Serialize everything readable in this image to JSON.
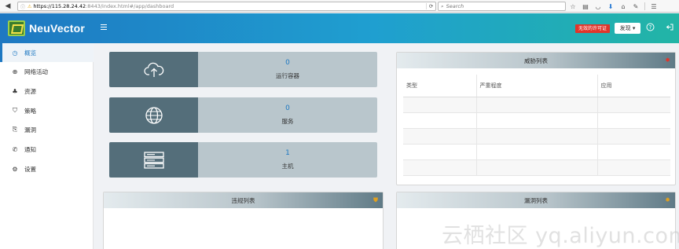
{
  "browser": {
    "url_host": "https://115.28.24.42",
    "url_rest": ":8443/index.html#/app/dashboard",
    "search_placeholder": "Search"
  },
  "header": {
    "logo_text": "NeuVector",
    "license_badge": "无效的许可证",
    "language_button": "发现 ▾"
  },
  "sidebar": {
    "items": [
      {
        "label": "概览",
        "icon": "dashboard-icon"
      },
      {
        "label": "网络活动",
        "icon": "globe-icon"
      },
      {
        "label": "资源",
        "icon": "resources-icon"
      },
      {
        "label": "策略",
        "icon": "shield-icon"
      },
      {
        "label": "漏洞",
        "icon": "vulnerability-icon"
      },
      {
        "label": "通知",
        "icon": "phone-icon"
      },
      {
        "label": "设置",
        "icon": "gear-icon"
      }
    ]
  },
  "stats": [
    {
      "value": "0",
      "label": "运行容器",
      "icon": "cloud-upload-icon"
    },
    {
      "value": "0",
      "label": "服务",
      "icon": "globe-icon"
    },
    {
      "value": "1",
      "label": "主机",
      "icon": "server-icon"
    }
  ],
  "threat_panel": {
    "title": "威胁列表",
    "columns": [
      "类型",
      "严重程度",
      "应用"
    ]
  },
  "violation_panel": {
    "title": "违规列表"
  },
  "vulnerability_panel": {
    "title": "漏洞列表"
  },
  "watermark": "云栖社区 yq.aliyun.com",
  "colors": {
    "accent": "#1e78c2",
    "header_start": "#1e78c2",
    "header_end": "#22b5a6",
    "license_red": "#e0352b",
    "card_icon_bg": "#546e7a",
    "card_bg": "#b9c6cc"
  }
}
